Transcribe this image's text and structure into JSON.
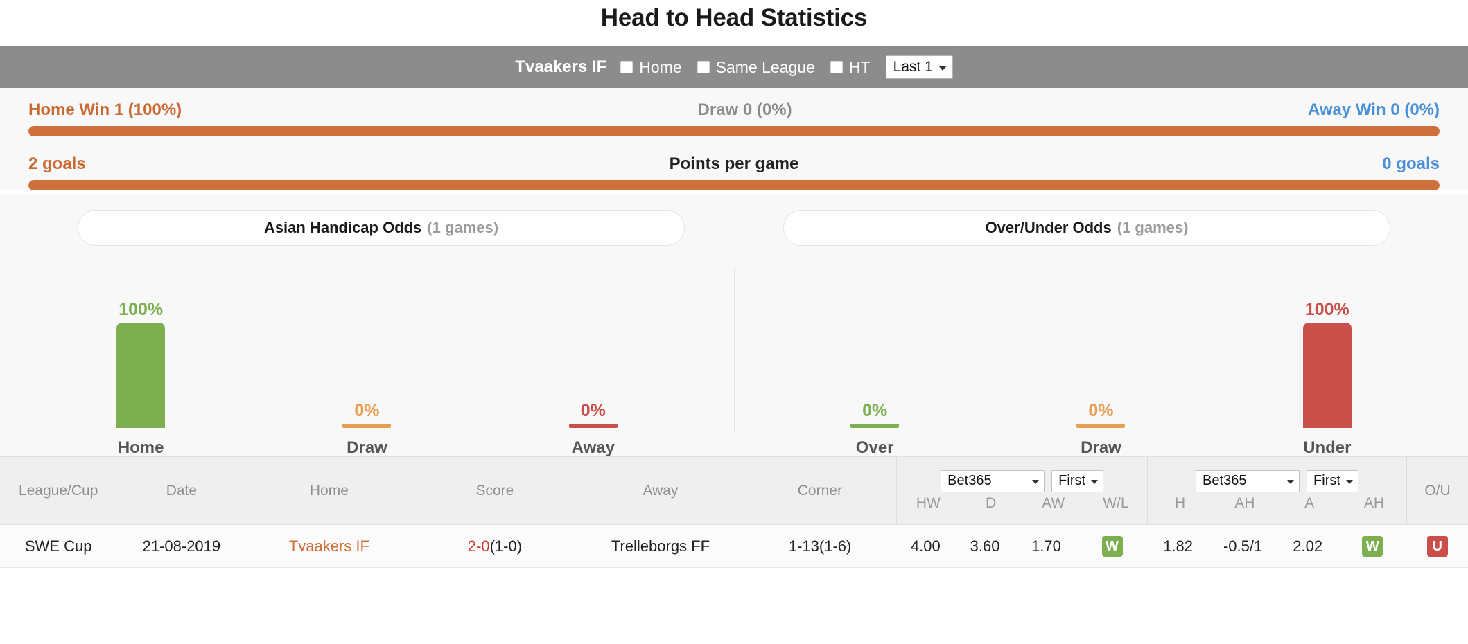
{
  "page_title": "Head to Head Statistics",
  "filter_bar": {
    "team": "Tvaakers IF",
    "checkbox_home": "Home",
    "checkbox_same_league": "Same League",
    "checkbox_ht": "HT",
    "range_select": "Last 1",
    "caret_icon": "chevron-down-icon"
  },
  "summary": {
    "result_row": {
      "left": "Home Win 1 (100%)",
      "middle": "Draw 0 (0%)",
      "right": "Away Win 0 (0%)",
      "left_pct": 100,
      "draw_pct": 0,
      "right_pct": 0
    },
    "points_row": {
      "left": "2 goals",
      "middle": "Points per game",
      "right": "0 goals",
      "left_pct": 100,
      "right_pct": 0
    }
  },
  "odds_tabs": {
    "asian": {
      "label": "Asian Handicap Odds",
      "games": "(1 games)"
    },
    "overunder": {
      "label": "Over/Under Odds",
      "games": "(1 games)"
    }
  },
  "chart_data": [
    {
      "type": "bar",
      "title": "Asian Handicap Odds",
      "categories": [
        "Home",
        "Draw",
        "Away"
      ],
      "values": [
        100,
        0,
        0
      ],
      "labels": [
        "100%",
        "0%",
        "0%"
      ],
      "colors": [
        "#7daf51",
        "#e79d52",
        "#c9504a"
      ],
      "ylabel": "",
      "xlabel": "",
      "ylim": [
        0,
        100
      ],
      "grid": false
    },
    {
      "type": "bar",
      "title": "Over/Under Odds",
      "categories": [
        "Over",
        "Draw",
        "Under"
      ],
      "values": [
        0,
        0,
        100
      ],
      "labels": [
        "0%",
        "0%",
        "100%"
      ],
      "colors": [
        "#7daf51",
        "#e79d52",
        "#c9504a"
      ],
      "ylabel": "",
      "xlabel": "",
      "ylim": [
        0,
        100
      ],
      "grid": false
    }
  ],
  "table": {
    "base_headers": [
      "League/Cup",
      "Date",
      "Home",
      "Score",
      "Away",
      "Corner"
    ],
    "group1": {
      "bookmaker": "Bet365",
      "period": "First",
      "subheaders": [
        "HW",
        "D",
        "AW",
        "W/L"
      ]
    },
    "group2": {
      "bookmaker": "Bet365",
      "period": "First",
      "subheaders": [
        "H",
        "AH",
        "A",
        "AH"
      ]
    },
    "group3": {
      "header": "O/U"
    },
    "rows": [
      {
        "league": "SWE Cup",
        "date": "21-08-2019",
        "home": "Tvaakers IF",
        "score_main": "2-0",
        "score_ht": "(1-0)",
        "away": "Trelleborgs FF",
        "corner": "1-13(1-6)",
        "hw": "4.00",
        "d": "3.60",
        "aw": "1.70",
        "wl": "W",
        "h": "1.82",
        "ah1": "-0.5/1",
        "a": "2.02",
        "ah2": "W",
        "ou": "U"
      }
    ]
  },
  "colors": {
    "orange": "#cd703c",
    "blue": "#4a90d9",
    "green": "#7daf51",
    "red": "#c9504a",
    "amber": "#e79d52",
    "bar_bg": "#8c8c8c",
    "highlight": "#fdf8e3"
  }
}
